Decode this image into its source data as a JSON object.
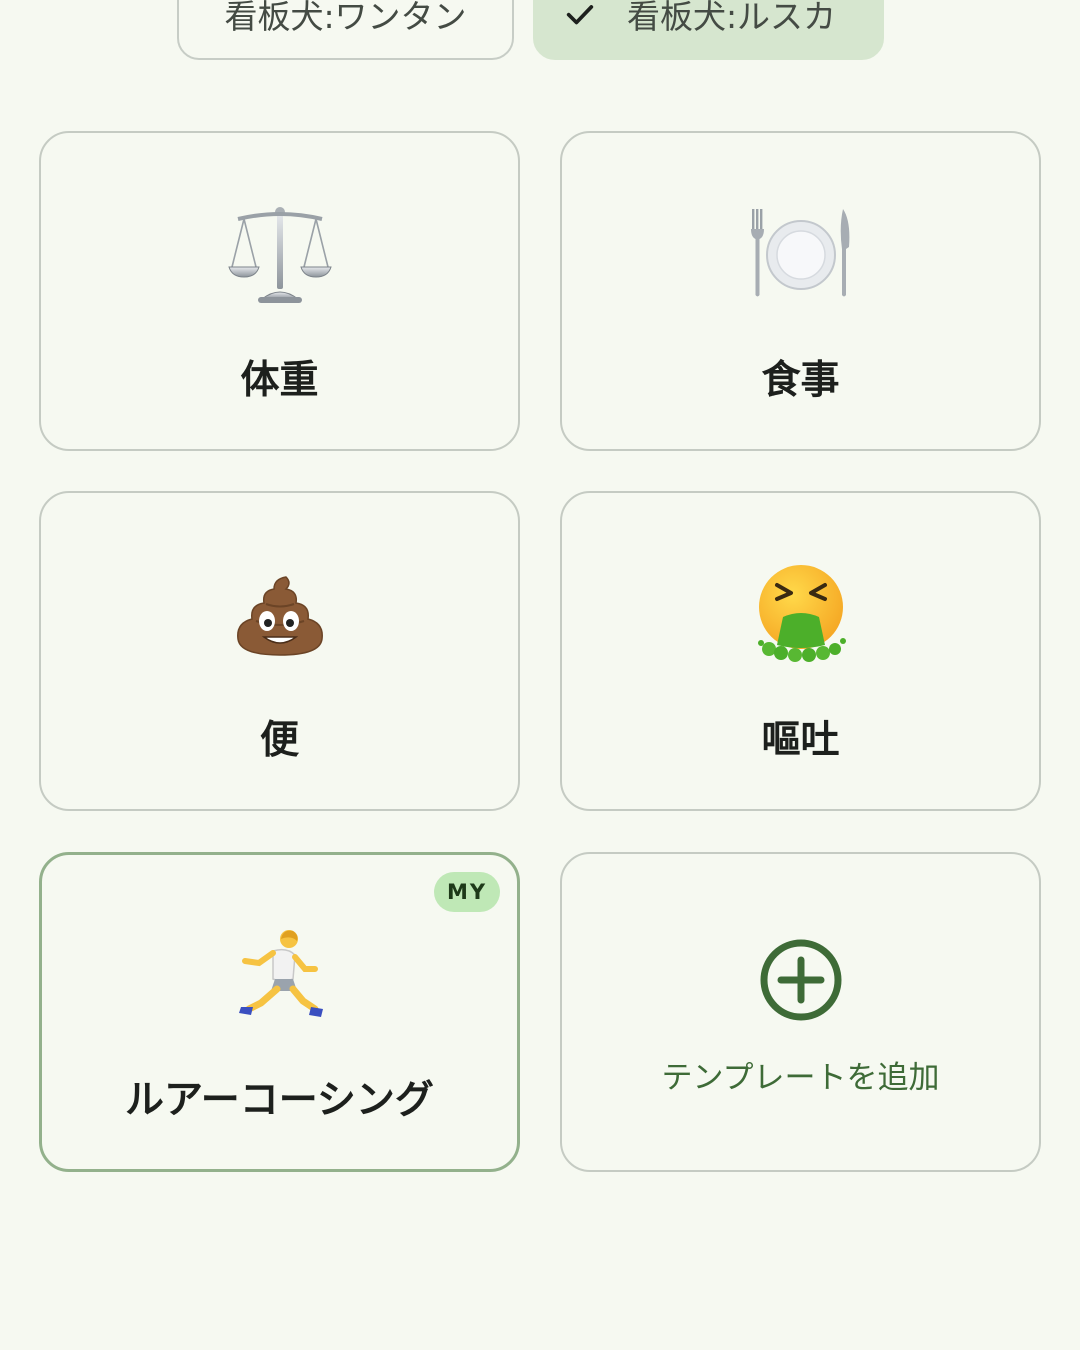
{
  "filters": {
    "chip_1": "看板犬:ワンタン",
    "chip_2": "看板犬:ルスカ"
  },
  "templates": [
    {
      "label": "体重",
      "icon": "scale-icon"
    },
    {
      "label": "食事",
      "icon": "plate-icon"
    },
    {
      "label": "便",
      "icon": "poop-icon"
    },
    {
      "label": "嘔吐",
      "icon": "vomit-icon"
    },
    {
      "label": "ルアーコーシング",
      "icon": "runner-icon",
      "badge": "MY"
    }
  ],
  "add_template": {
    "label": "テンプレートを追加",
    "icon": "add-circle-icon"
  },
  "colors": {
    "background": "#f6f9f1",
    "selected_chip": "#d6e6cf",
    "accent_green": "#3e6b37",
    "badge_bg": "#bfe8b6"
  }
}
